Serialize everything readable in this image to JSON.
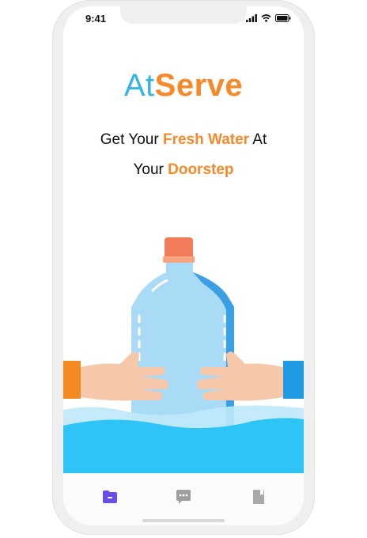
{
  "status": {
    "time": "9:41"
  },
  "brand": {
    "part1": "At",
    "part2": "Serve",
    "color1": "#33b5e5",
    "color2": "#f7892b"
  },
  "tagline": {
    "line1_a": "Get Your ",
    "line1_b": "Fresh Water",
    "line1_c": " At",
    "line2_a": "Your ",
    "line2_b": "Doorstep"
  },
  "illustration": {
    "subject": "water-bottle-held-by-hands"
  },
  "nav": [
    {
      "icon": "folder-icon",
      "active": true
    },
    {
      "icon": "chat-icon",
      "active": false
    },
    {
      "icon": "book-icon",
      "active": false
    }
  ]
}
